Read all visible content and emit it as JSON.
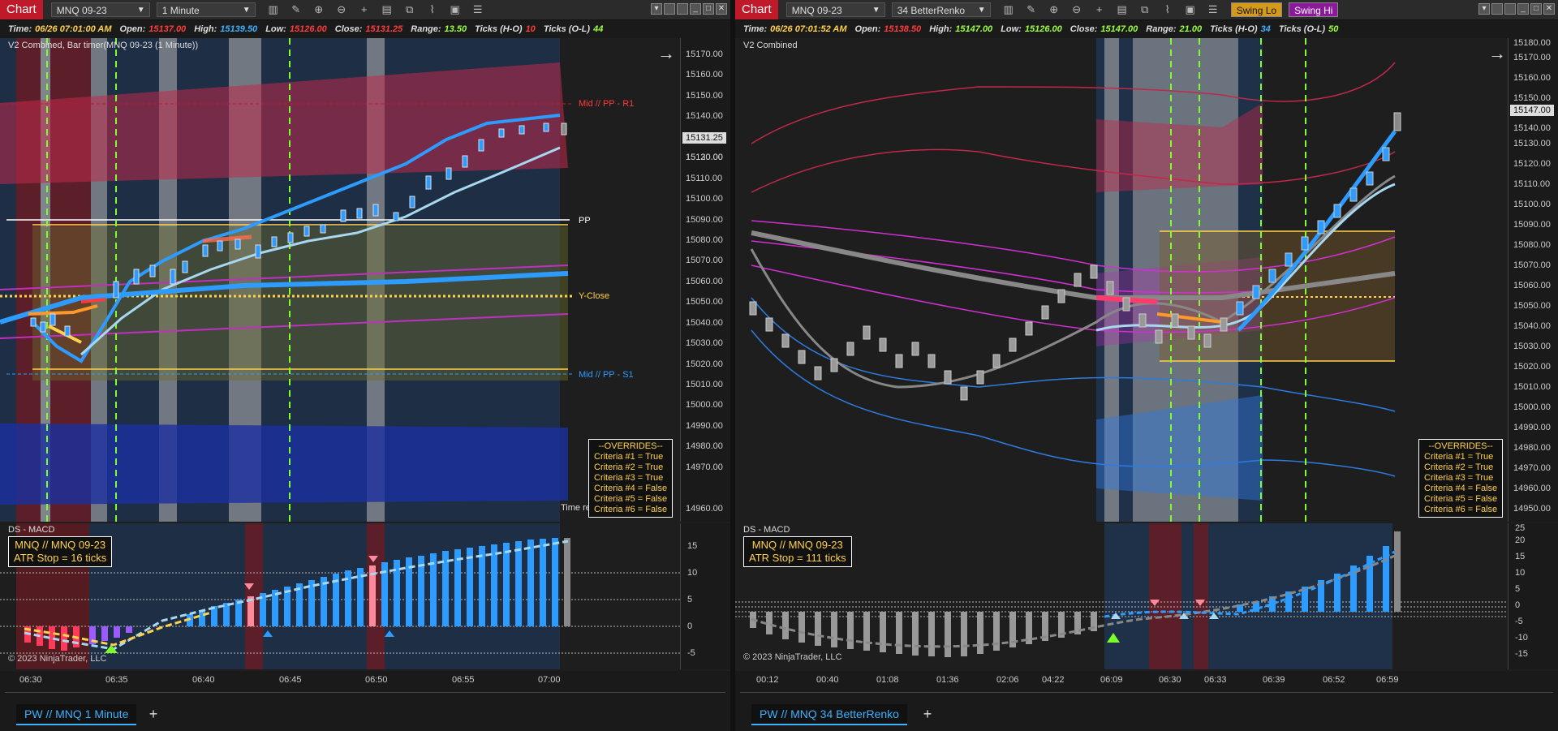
{
  "left": {
    "tab_label": "Chart",
    "instrument": "MNQ 09-23",
    "timeframe": "1 Minute",
    "databox": {
      "time_label": "Time:",
      "time": "06/26 07:01:00 AM",
      "open_label": "Open:",
      "open": "15137.00",
      "high_label": "High:",
      "high": "15139.50",
      "low_label": "Low:",
      "low": "15126.00",
      "close_label": "Close:",
      "close": "15131.25",
      "range_label": "Range:",
      "range": "13.50",
      "ticks_ho_label": "Ticks (H-O)",
      "ticks_ho": "10",
      "ticks_ol_label": "Ticks (O-L)",
      "ticks_ol": "44"
    },
    "indicator_title": "V2 Combined, Bar timer(MNQ 09-23 (1 Minute))",
    "levels": {
      "r1": "Mid // PP - R1",
      "pp": "PP",
      "yclose": "Y-Close",
      "s1": "Mid // PP - S1"
    },
    "time_remaining": "Time re",
    "current_price": "15131.25",
    "price_ticks": [
      "15170.00",
      "15160.00",
      "15150.00",
      "15140.00",
      "15130.00",
      "15120.00",
      "15110.00",
      "15100.00",
      "15090.00",
      "15080.00",
      "15070.00",
      "15060.00",
      "15050.00",
      "15040.00",
      "15030.00",
      "15020.00",
      "15010.00",
      "15000.00",
      "14990.00",
      "14980.00",
      "14970.00",
      "14960.00"
    ],
    "overrides": [
      "--OVERRIDES--",
      "Criteria #1 = True",
      "Criteria #2 = True",
      "Criteria #3 = True",
      "Criteria #4 = False",
      "Criteria #5 = False",
      "Criteria #6 = False"
    ],
    "macd_title": "DS - MACD",
    "atr_line1": "MNQ // MNQ 09-23",
    "atr_line2": "ATR Stop = 16 ticks",
    "macd_ticks": [
      "15",
      "10",
      "5",
      "0",
      "-5"
    ],
    "copyright": "© 2023 NinjaTrader, LLC",
    "time_ticks": [
      "06:30",
      "06:35",
      "06:40",
      "06:45",
      "06:50",
      "06:55",
      "07:00"
    ],
    "bottom_tab": "PW // MNQ  1 Minute",
    "add_tab": "+"
  },
  "right": {
    "tab_label": "Chart",
    "instrument": "MNQ 09-23",
    "timeframe": "34 BetterRenko",
    "swing_lo": "Swing Lo",
    "swing_hi": "Swing Hi",
    "databox": {
      "time_label": "Time:",
      "time": "06/26 07:01:52 AM",
      "open_label": "Open:",
      "open": "15138.50",
      "high_label": "High:",
      "high": "15147.00",
      "low_label": "Low:",
      "low": "15126.00",
      "close_label": "Close:",
      "close": "15147.00",
      "range_label": "Range:",
      "range": "21.00",
      "ticks_ho_label": "Ticks (H-O)",
      "ticks_ho": "34",
      "ticks_ol_label": "Ticks (O-L)",
      "ticks_ol": "50"
    },
    "indicator_title": "V2 Combined",
    "current_price": "15147.00",
    "price_ticks": [
      "15180.00",
      "15170.00",
      "15160.00",
      "15150.00",
      "15140.00",
      "15130.00",
      "15120.00",
      "15110.00",
      "15100.00",
      "15090.00",
      "15080.00",
      "15070.00",
      "15060.00",
      "15050.00",
      "15040.00",
      "15030.00",
      "15020.00",
      "15010.00",
      "15000.00",
      "14990.00",
      "14980.00",
      "14970.00",
      "14960.00",
      "14950.00"
    ],
    "overrides": [
      "--OVERRIDES--",
      "Criteria #1 = True",
      "Criteria #2 = True",
      "Criteria #3 = True",
      "Criteria #4 = False",
      "Criteria #5 = False",
      "Criteria #6 = False"
    ],
    "macd_title": "DS - MACD",
    "atr_line1": "MNQ // MNQ 09-23",
    "atr_line2": "ATR Stop = 111 ticks",
    "macd_ticks": [
      "25",
      "20",
      "15",
      "10",
      "5",
      "0",
      "-5",
      "-10",
      "-15"
    ],
    "copyright": "© 2023 NinjaTrader, LLC",
    "time_ticks": [
      "00:12",
      "00:40",
      "01:08",
      "01:36",
      "02:06",
      "04:22",
      "06:09",
      "06:30",
      "06:33",
      "06:39",
      "06:52",
      "06:59"
    ],
    "bottom_tab": "PW // MNQ  34 BetterRenko",
    "add_tab": "+"
  },
  "colors": {
    "accent": "#c0192a",
    "up": "#2e9bff",
    "down": "#ff4b6a",
    "yellow": "#ffd24a"
  }
}
